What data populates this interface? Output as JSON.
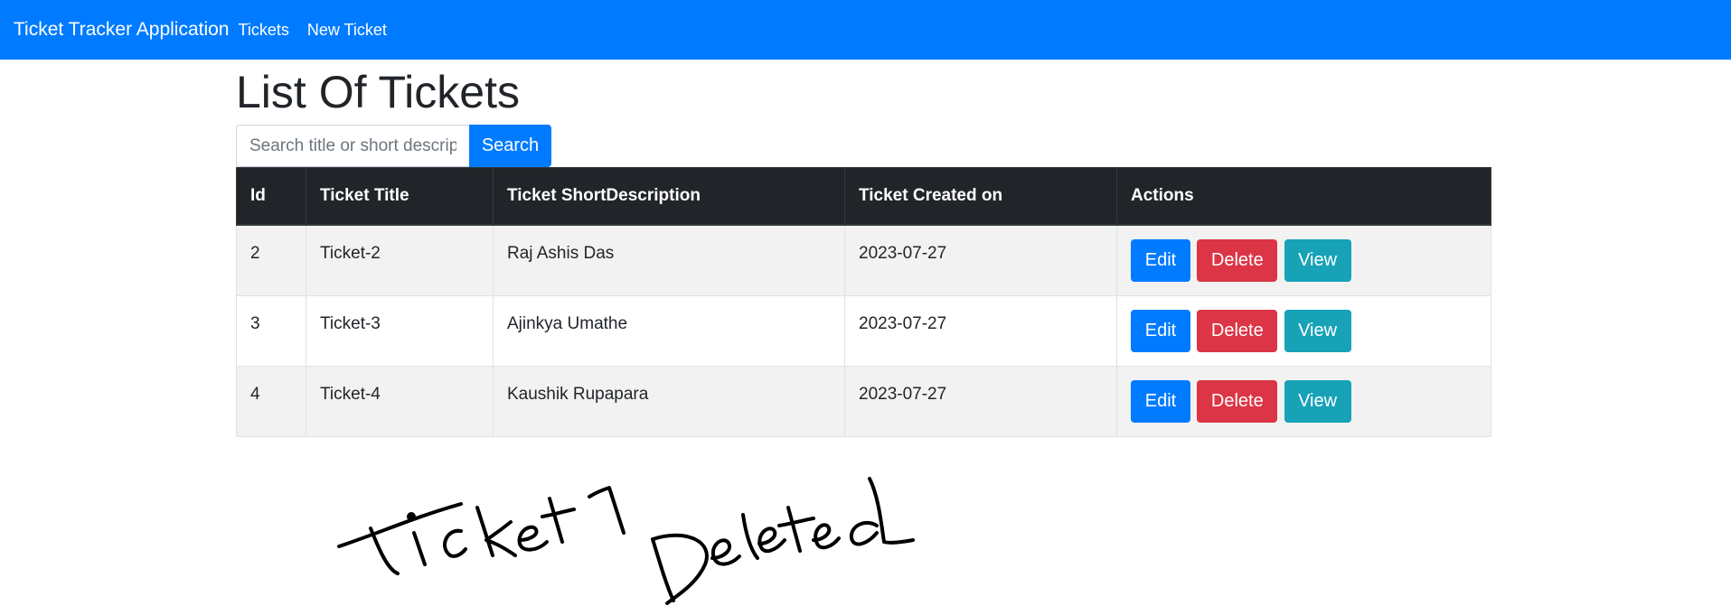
{
  "navbar": {
    "brand": "Ticket Tracker Application",
    "links": [
      "Tickets",
      "New Ticket"
    ],
    "bg_color": "#007bff"
  },
  "page": {
    "title": "List Of Tickets"
  },
  "search": {
    "placeholder": "Search title or short description",
    "button_label": "Search"
  },
  "table": {
    "headers": [
      "Id",
      "Ticket Title",
      "Ticket ShortDescription",
      "Ticket Created on",
      "Actions"
    ],
    "rows": [
      {
        "id": "2",
        "title": "Ticket-2",
        "short_description": "Raj Ashis Das",
        "created_on": "2023-07-27"
      },
      {
        "id": "3",
        "title": "Ticket-3",
        "short_description": "Ajinkya Umathe",
        "created_on": "2023-07-27"
      },
      {
        "id": "4",
        "title": "Ticket-4",
        "short_description": "Kaushik Rupapara",
        "created_on": "2023-07-27"
      }
    ],
    "actions": {
      "edit": "Edit",
      "delete": "Delete",
      "view": "View"
    }
  },
  "annotation": {
    "handwritten_text": "Ticket1 Deleted"
  },
  "colors": {
    "primary": "#007bff",
    "danger": "#dc3545",
    "info": "#17a2b8",
    "dark": "#212529"
  }
}
